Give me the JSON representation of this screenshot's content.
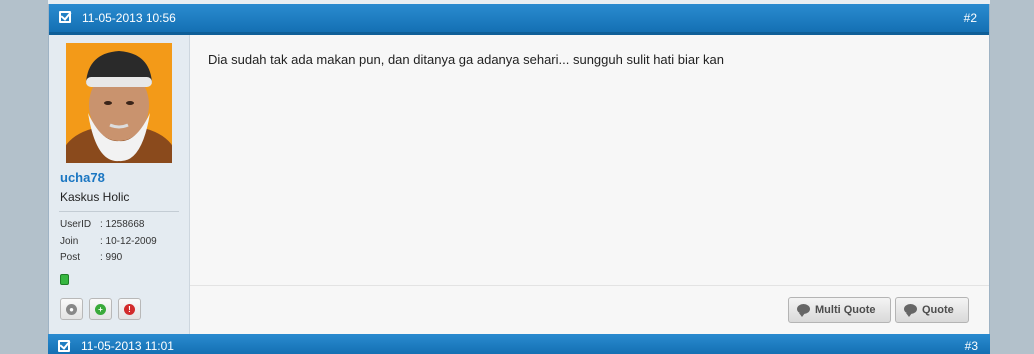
{
  "post": {
    "date": "11-05-2013 10:56",
    "number": "#2",
    "message": "Dia sudah tak ada makan pun, dan ditanya ga adanya sehari... sungguh sulit hati biar kan",
    "user": {
      "username": "ucha78",
      "title": "Kaskus Holic",
      "info": [
        {
          "label": "UserID",
          "value": ": 1258668"
        },
        {
          "label": "Join",
          "value": ": 10-12-2009"
        },
        {
          "label": "Post",
          "value": ": 990"
        }
      ],
      "online_status_color": "#36b640"
    },
    "side_buttons": [
      {
        "icon": "user-profile-icon",
        "color": "#888888"
      },
      {
        "icon": "add-reputation-icon",
        "color": "#3aaa3a"
      },
      {
        "icon": "report-icon",
        "color": "#d22b2b"
      }
    ],
    "actions": {
      "multi_quote": "Multi Quote",
      "quote": "Quote"
    }
  },
  "next_post": {
    "date": "11-05-2013 11:01",
    "number": "#3"
  },
  "colors": {
    "header_blue": "#1f7fc4",
    "username_blue": "#1a76c2",
    "page_bg": "#b3c1cb"
  }
}
